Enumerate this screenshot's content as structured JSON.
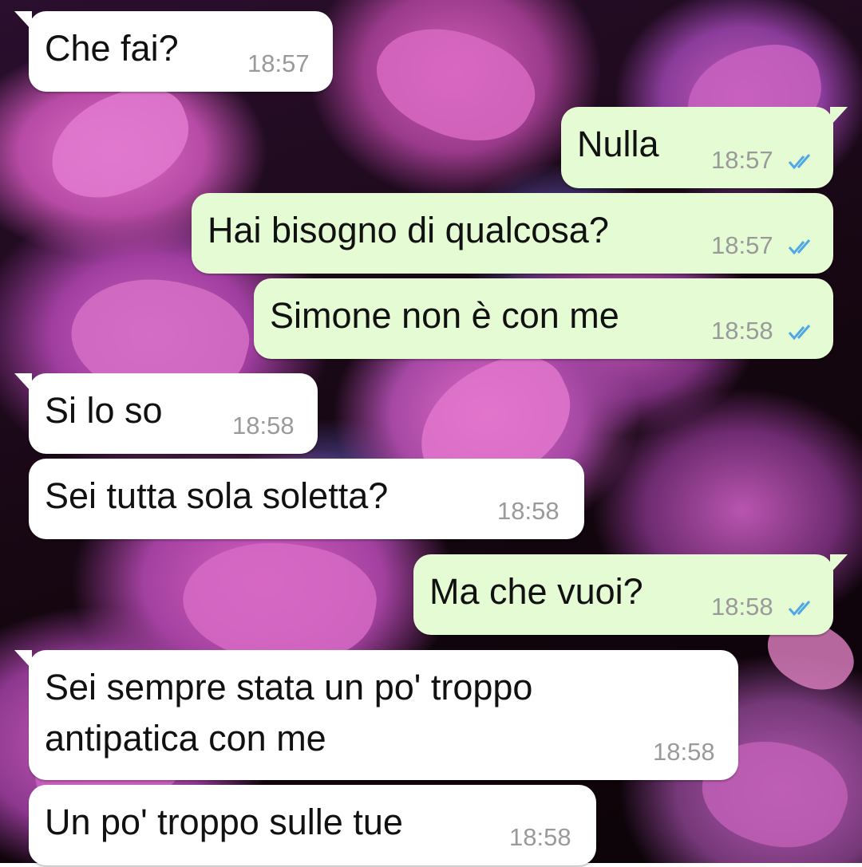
{
  "messages": [
    {
      "direction": "incoming",
      "text": "Che fai?",
      "time": "18:57"
    },
    {
      "direction": "outgoing",
      "text": "Nulla",
      "time": "18:57",
      "status": "read-double-check-icon"
    },
    {
      "direction": "outgoing",
      "text": "Hai bisogno di qualcosa?",
      "time": "18:57",
      "status": "read-double-check-icon"
    },
    {
      "direction": "outgoing",
      "text": "Simone non è con me",
      "time": "18:58",
      "status": "read-double-check-icon"
    },
    {
      "direction": "incoming",
      "text": "Si lo so",
      "time": "18:58"
    },
    {
      "direction": "incoming",
      "text": "Sei tutta sola soletta?",
      "time": "18:58"
    },
    {
      "direction": "outgoing",
      "text": "Ma che vuoi?",
      "time": "18:58",
      "status": "read-double-check-icon"
    },
    {
      "direction": "incoming",
      "text_lines": [
        "Sei sempre stata un po' troppo",
        "antipatica con me"
      ],
      "time": "18:58"
    },
    {
      "direction": "incoming",
      "text": "Un po' troppo sulle tue",
      "time": "18:58"
    }
  ],
  "colors": {
    "incoming_bubble": "#ffffff",
    "outgoing_bubble": "#e5fbd4",
    "timestamp": "#9a9a9a",
    "read_tick": "#4fa8e6"
  },
  "wallpaper": "purple-flowers-background"
}
